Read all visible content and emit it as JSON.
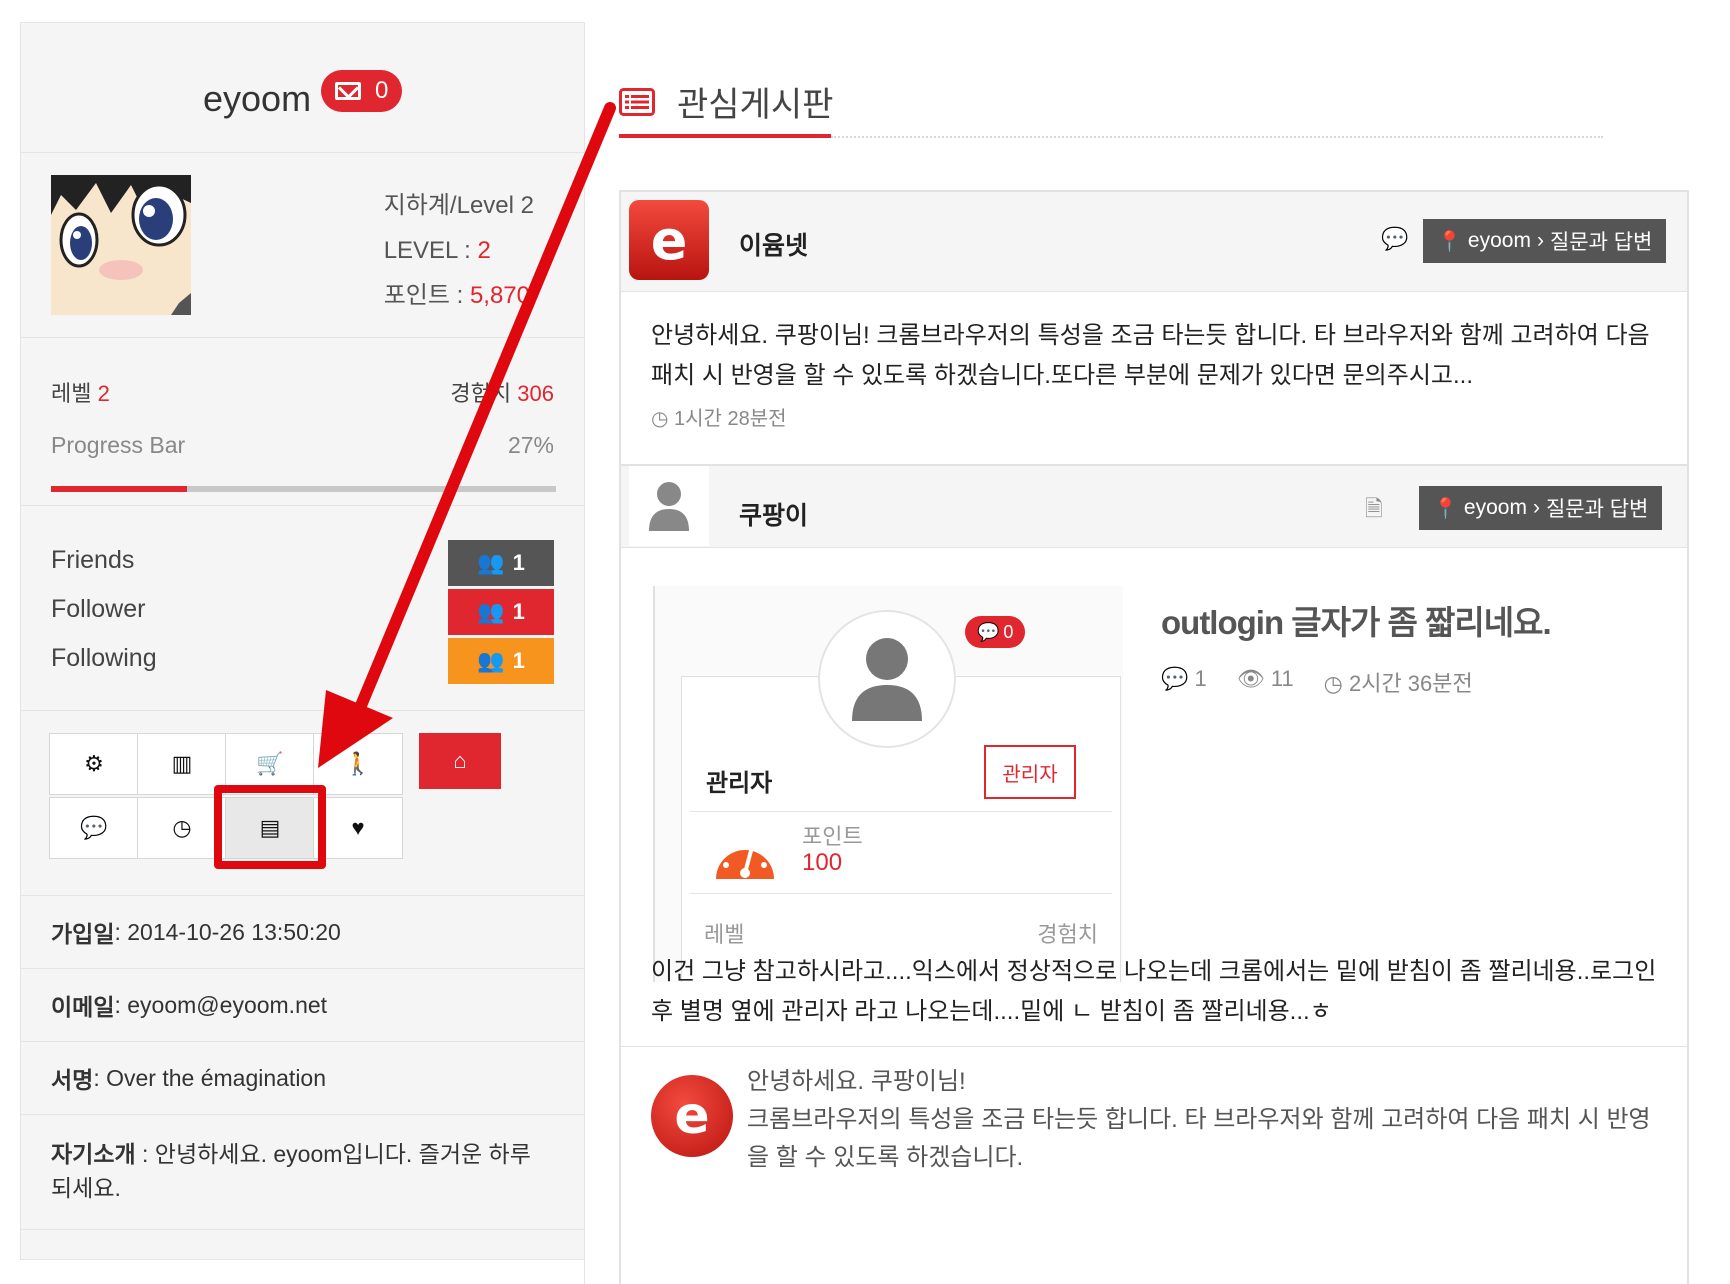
{
  "sidebar": {
    "username": "eyoom",
    "mail_count": "0",
    "stats": {
      "grade_label": "지하계/Level 2",
      "level_label": "LEVEL : ",
      "level_value": "2",
      "point_label": "포인트 : ",
      "point_value": "5,870"
    },
    "level": {
      "level_label": "레벨",
      "level_value": "2",
      "exp_label": "경험치",
      "exp_value": "306",
      "progress_label": "Progress Bar",
      "progress_pct_text": "27%",
      "progress_fraction": 0.27
    },
    "friends": [
      {
        "label": "Friends",
        "count": "1",
        "color": "#555555"
      },
      {
        "label": "Follower",
        "count": "1",
        "color": "#e0262f"
      },
      {
        "label": "Following",
        "count": "1",
        "color": "#f7941d"
      }
    ],
    "buttons": [
      {
        "name": "settings-button",
        "icon": "gear-icon",
        "glyph": "⚙"
      },
      {
        "name": "stats-button",
        "icon": "bar-chart-icon",
        "glyph": "▥"
      },
      {
        "name": "cart-button",
        "icon": "cart-icon",
        "glyph": "🛒"
      },
      {
        "name": "person-button",
        "icon": "person-icon",
        "glyph": "🚶"
      },
      {
        "name": "home-button",
        "icon": "home-icon",
        "glyph": "⌂"
      },
      {
        "name": "comments-button",
        "icon": "comments-icon",
        "glyph": "💬"
      },
      {
        "name": "clock-button",
        "icon": "clock-icon",
        "glyph": "◷"
      },
      {
        "name": "board-list-button",
        "icon": "list-icon",
        "glyph": "▤"
      },
      {
        "name": "heart-button",
        "icon": "heart-icon",
        "glyph": "♥"
      }
    ],
    "info": {
      "joined_label": "가입일",
      "joined_value": " : 2014-10-26 13:50:20",
      "email_label": "이메일",
      "email_value": " : eyoom@eyoom.net",
      "sign_label": "서명",
      "sign_value": " : Over the émagination",
      "intro_label": "자기소개",
      "intro_value": " : 안녕하세요. eyoom입니다. 즐거운 하루 되세요."
    }
  },
  "main": {
    "title": "관심게시판",
    "cards": [
      {
        "name": "이윰넷",
        "tag_site": "eyoom",
        "tag_board": "질문과 답변",
        "text": "안녕하세요. 쿠팡이님! 크롬브라우저의 특성을 조금 타는듯 합니다. 타 브라우저와 함께 고려하여 다음 패치 시 반영을 할 수 있도록 하겠습니다.또다른 부분에 문제가 있다면 문의주시고...",
        "time": "1시간 28분전"
      },
      {
        "name": "쿠팡이",
        "tag_site": "eyoom",
        "tag_board": "질문과 답변",
        "post_title": "outlogin 글자가 좀 짧리네요.",
        "comments": "1",
        "views": "11",
        "time": "2시간 36분전",
        "inner": {
          "chat_count": "0",
          "user": "관리자",
          "badge": "관리자",
          "point_label": "포인트",
          "point_value": "100",
          "level_label": "레벨",
          "exp_label": "경험치"
        },
        "text": "이건 그냥 참고하시라고....익스에서 정상적으로 나오는데 크롬에서는 밑에 받침이 좀 짤리네용..로그인 후 별명 옆에 관리자 라고 나오는데....밑에 ㄴ 받침이 좀 짤리네용...ㅎ",
        "reply_line1": "안녕하세요. 쿠팡이님!",
        "reply_line2": "크롬브라우저의 특성을 조금 타는듯 합니다. 타 브라우저와 함께 고려하여 다음 패치 시 반영을 할 수 있도록 하겠습니다."
      }
    ]
  },
  "colors": {
    "accent": "#e0262f",
    "tag_bg": "#555555",
    "arrow": "#e0080f"
  }
}
